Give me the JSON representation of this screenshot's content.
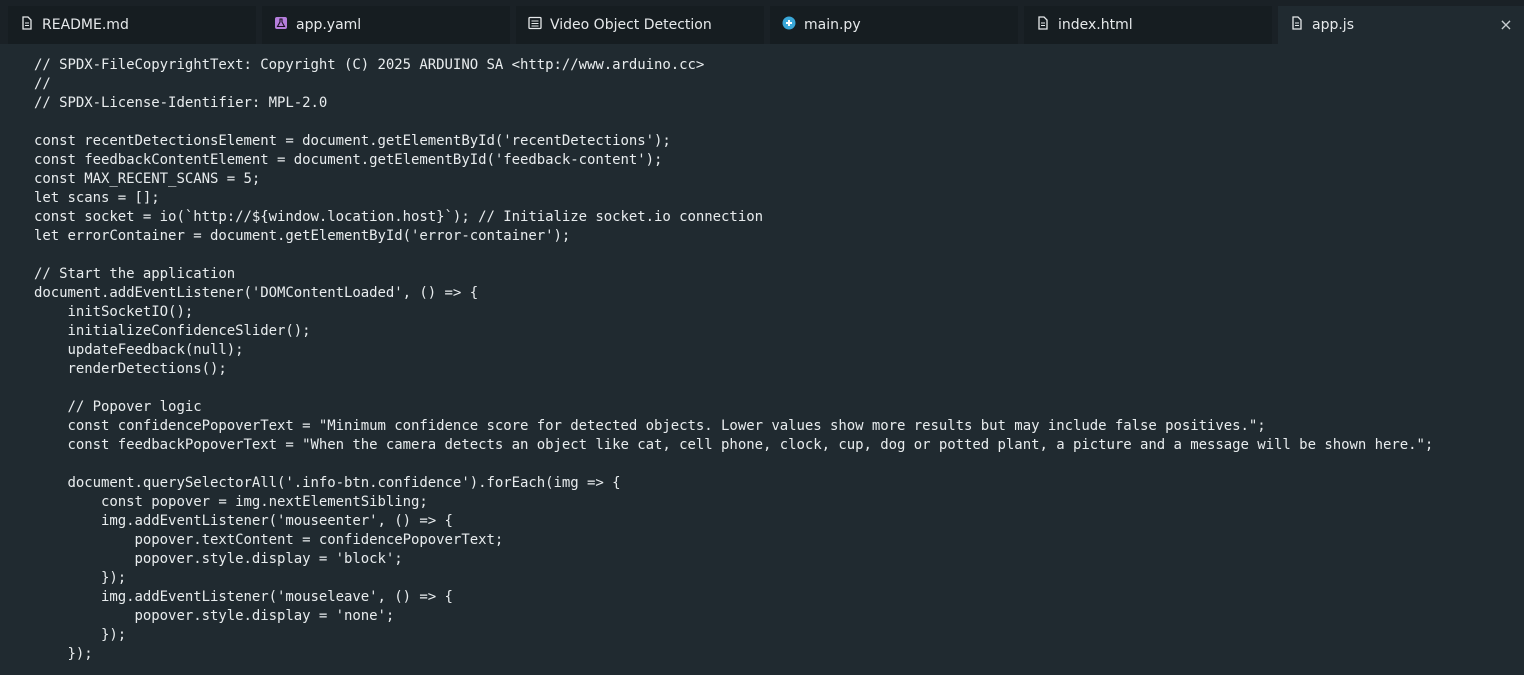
{
  "tabs": [
    {
      "label": "README.md",
      "icon": "file-icon"
    },
    {
      "label": "app.yaml",
      "icon": "flask-icon"
    },
    {
      "label": "Video Object Detection",
      "icon": "list-icon"
    },
    {
      "label": "main.py",
      "icon": "python-icon"
    },
    {
      "label": "index.html",
      "icon": "file-icon"
    },
    {
      "label": "app.js",
      "icon": "file-icon",
      "active": true
    }
  ],
  "close_glyph": "×",
  "colors": {
    "background": "#202a30",
    "tabbar": "#1a2126",
    "inactive_tab": "#161d21",
    "text": "#e8ecee",
    "flask_icon": "#b57edc",
    "python_icon": "#3aa7d8"
  },
  "code_lines": [
    "// SPDX-FileCopyrightText: Copyright (C) 2025 ARDUINO SA <http://www.arduino.cc>",
    "//",
    "// SPDX-License-Identifier: MPL-2.0",
    "",
    "const recentDetectionsElement = document.getElementById('recentDetections');",
    "const feedbackContentElement = document.getElementById('feedback-content');",
    "const MAX_RECENT_SCANS = 5;",
    "let scans = [];",
    "const socket = io(`http://${window.location.host}`); // Initialize socket.io connection",
    "let errorContainer = document.getElementById('error-container');",
    "",
    "// Start the application",
    "document.addEventListener('DOMContentLoaded', () => {",
    "    initSocketIO();",
    "    initializeConfidenceSlider();",
    "    updateFeedback(null);",
    "    renderDetections();",
    "",
    "    // Popover logic",
    "    const confidencePopoverText = \"Minimum confidence score for detected objects. Lower values show more results but may include false positives.\";",
    "    const feedbackPopoverText = \"When the camera detects an object like cat, cell phone, clock, cup, dog or potted plant, a picture and a message will be shown here.\";",
    "",
    "    document.querySelectorAll('.info-btn.confidence').forEach(img => {",
    "        const popover = img.nextElementSibling;",
    "        img.addEventListener('mouseenter', () => {",
    "            popover.textContent = confidencePopoverText;",
    "            popover.style.display = 'block';",
    "        });",
    "        img.addEventListener('mouseleave', () => {",
    "            popover.style.display = 'none';",
    "        });",
    "    });"
  ]
}
